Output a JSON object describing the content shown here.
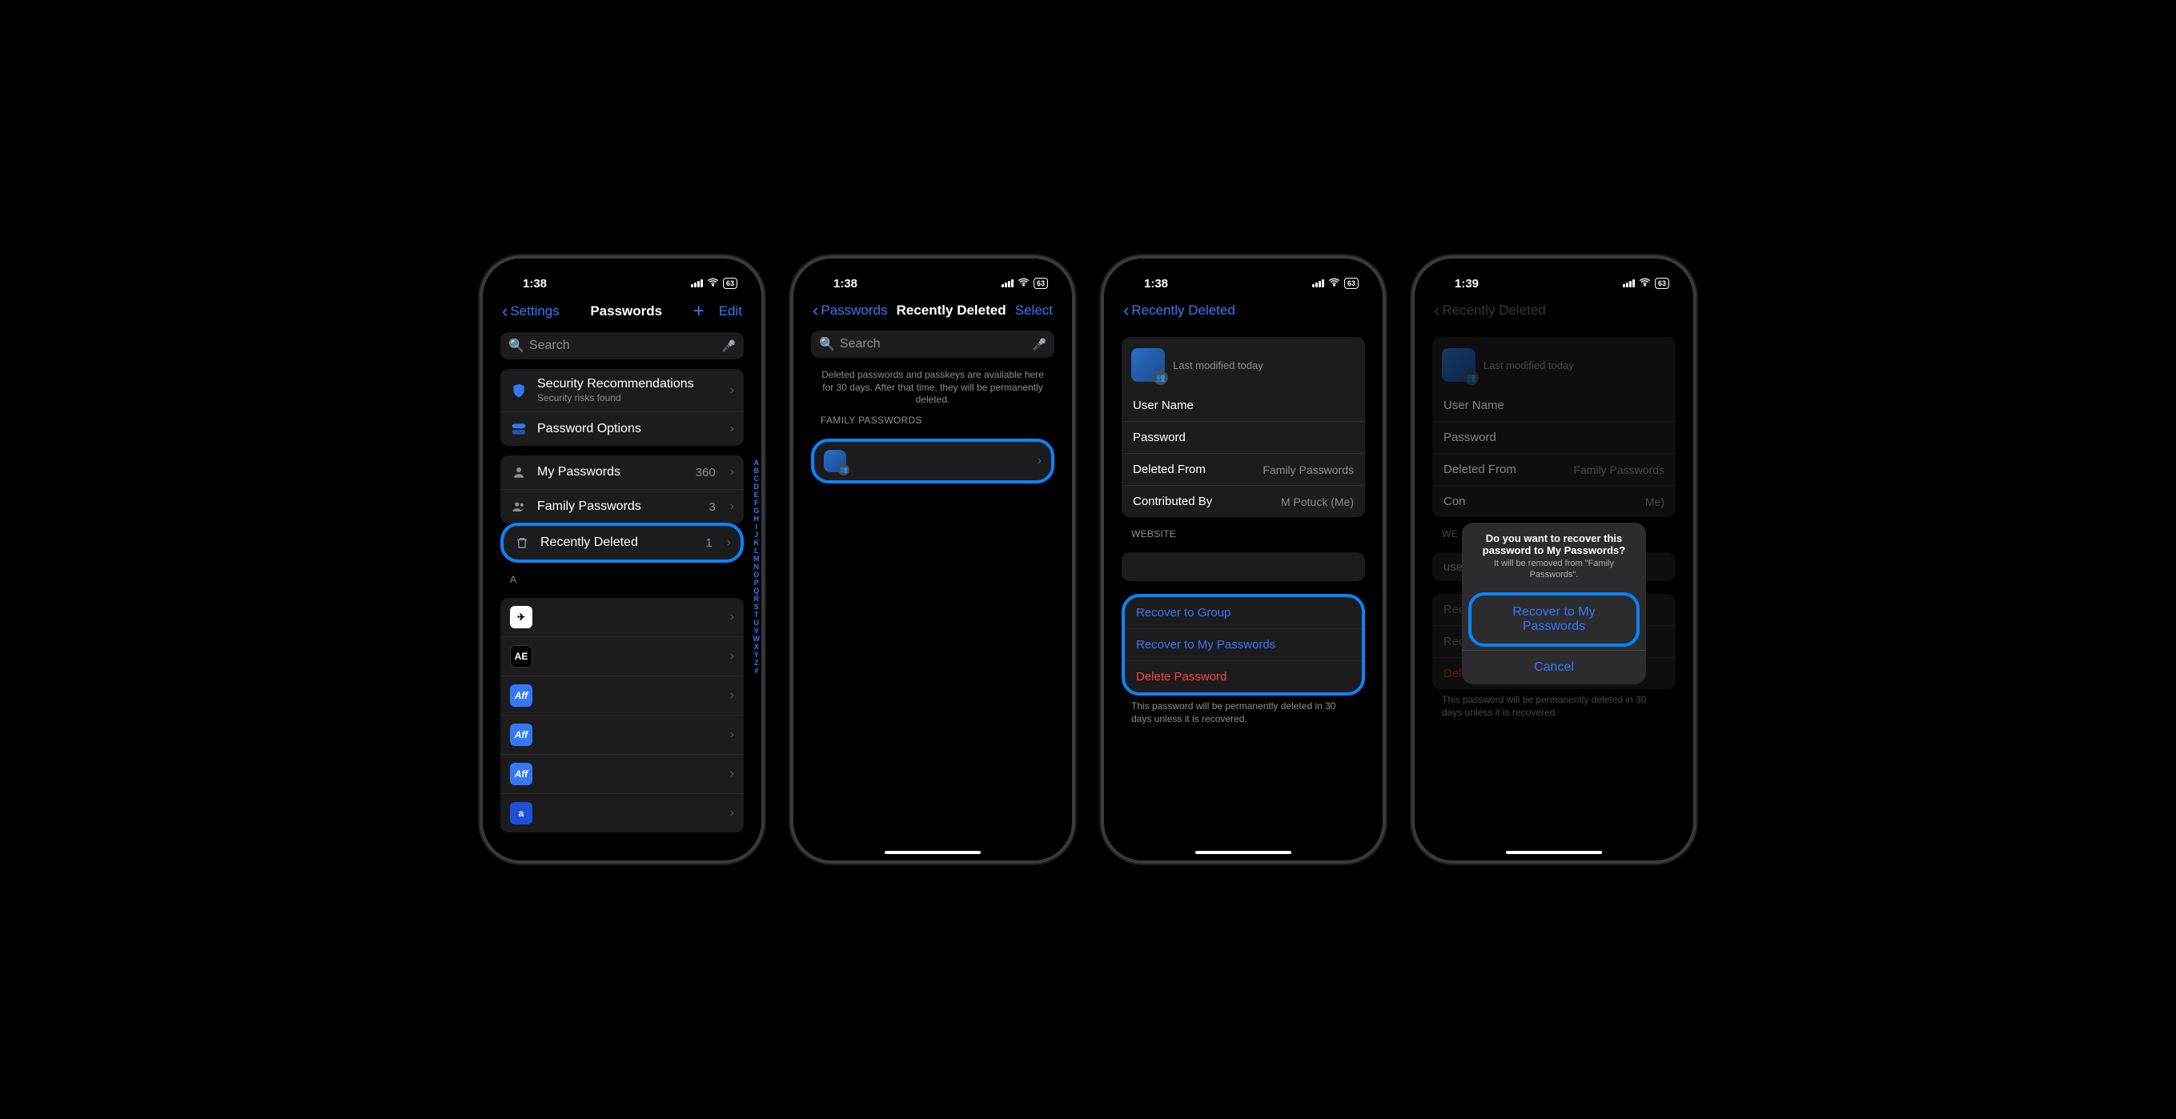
{
  "status": {
    "time_a": "1:38",
    "time_b": "1:39",
    "battery": "63"
  },
  "p1": {
    "back": "Settings",
    "title": "Passwords",
    "edit": "Edit",
    "search": "Search",
    "sec_rec": "Security Recommendations",
    "sec_sub": "Security risks found",
    "pw_options": "Password Options",
    "my_pw": "My Passwords",
    "my_pw_n": "360",
    "fam_pw": "Family Passwords",
    "fam_pw_n": "3",
    "rec_del": "Recently Deleted",
    "rec_del_n": "1",
    "letter": "A",
    "az": [
      "A",
      "B",
      "C",
      "D",
      "E",
      "F",
      "G",
      "H",
      "I",
      "J",
      "K",
      "L",
      "M",
      "N",
      "O",
      "P",
      "Q",
      "R",
      "S",
      "T",
      "U",
      "V",
      "W",
      "X",
      "Y",
      "Z",
      "#"
    ]
  },
  "p2": {
    "back": "Passwords",
    "title": "Recently Deleted",
    "select": "Select",
    "search": "Search",
    "info": "Deleted passwords and passkeys are available here for 30 days. After that time, they will be permanently deleted.",
    "group": "FAMILY PASSWORDS"
  },
  "p3": {
    "back": "Recently Deleted",
    "modified": "Last modified today",
    "user": "User Name",
    "pass": "Password",
    "delfrom": "Deleted From",
    "delfrom_v": "Family Passwords",
    "contrib": "Contributed By",
    "contrib_v": "M Potuck (Me)",
    "website": "WEBSITE",
    "rec_group": "Recover to Group",
    "rec_my": "Recover to My Passwords",
    "del": "Delete Password",
    "footer": "This password will be permanently deleted in 30 days unless it is recovered."
  },
  "p4": {
    "back": "Recently Deleted",
    "sheet_title": "Do you want to recover this password to My Passwords?",
    "sheet_sub": "It will be removed from \"Family Passwords\".",
    "recover": "Recover to My Passwords",
    "cancel": "Cancel"
  }
}
